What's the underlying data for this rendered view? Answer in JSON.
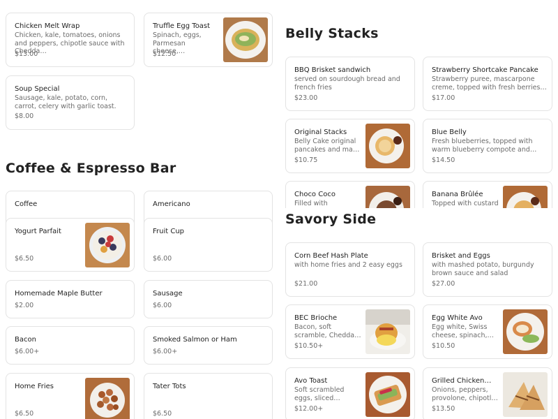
{
  "sections": {
    "coffee": {
      "title": "Coffee & Espresso Bar"
    },
    "belly": {
      "title": "Belly Stacks"
    },
    "savory": {
      "title": "Savory Side"
    }
  },
  "left_top": [
    {
      "name": "Chicken Melt Wrap",
      "desc": "Chicken, kale, tomatoes, onions and peppers, chipotle sauce with Chedda…",
      "price": "$13.00"
    },
    {
      "name": "Truffle Egg Toast",
      "desc": "Spinach, eggs, Parmesan cheese,…",
      "price": "$12.50",
      "icon": "truffle-egg-toast-image"
    },
    {
      "name": "Soup Special",
      "desc": "Sausage, kale, potato, corn, carrot, celery with garlic toast.",
      "price": "$8.00"
    }
  ],
  "coffee_items": [
    {
      "name": "Coffee"
    },
    {
      "name": "Americano"
    },
    {
      "name": "Yogurt Parfait",
      "price": "$6.50",
      "icon": "yogurt-parfait-image"
    },
    {
      "name": "Fruit Cup",
      "price": "$6.00"
    },
    {
      "name": "Homemade Maple Butter",
      "price": "$2.00"
    },
    {
      "name": "Sausage",
      "price": "$6.00"
    },
    {
      "name": "Bacon",
      "price": "$6.00+"
    },
    {
      "name": "Smoked Salmon or Ham",
      "price": "$6.00+"
    },
    {
      "name": "Home Fries",
      "price": "$6.50",
      "icon": "home-fries-image"
    },
    {
      "name": "Tater Tots",
      "price": "$6.50"
    }
  ],
  "belly_items": [
    {
      "name": "BBQ Brisket sandwich",
      "desc": "served on sourdough bread and french fries",
      "price": "$23.00"
    },
    {
      "name": "Strawberry Shortcake Pancake",
      "desc": "Strawberry puree, mascarpone creme, topped with fresh berries with maple…",
      "price": "$17.00"
    },
    {
      "name": "Original Stacks",
      "desc": "Belly Cake original pancakes and ma…",
      "price": "$10.75",
      "icon": "original-stacks-image"
    },
    {
      "name": "Blue Belly",
      "desc": "Fresh blueberries, topped with warm blueberry compote and maple butter…",
      "price": "$14.50"
    },
    {
      "name": "Choco Coco",
      "desc": "Filled with chocolate",
      "icon": "choco-coco-image"
    },
    {
      "name": "Banana Brûlée",
      "desc": "Topped with custard",
      "icon": "banana-brulee-image"
    }
  ],
  "savory_items": [
    {
      "name": "Corn Beef Hash Plate",
      "desc": "with home fries and 2 easy eggs",
      "price": "$21.00"
    },
    {
      "name": "Brisket and Eggs",
      "desc": "with mashed potato, burgundy brown sauce and salad",
      "price": "$27.00"
    },
    {
      "name": "BEC Brioche",
      "desc": "Bacon, soft scramble, Chedda…",
      "price": "$10.50+",
      "icon": "bec-brioche-image"
    },
    {
      "name": "Egg White Avo",
      "desc": "Egg white, Swiss cheese, spinach,…",
      "price": "$10.50",
      "icon": "egg-white-avo-image"
    },
    {
      "name": "Avo Toast",
      "desc": "Soft scrambled eggs, sliced…",
      "price": "$12.00+",
      "icon": "avo-toast-image"
    },
    {
      "name": "Grilled Chicken…",
      "desc": "Onions, peppers, provolone, chipotl…",
      "price": "$13.50",
      "icon": "grilled-chicken-image"
    }
  ]
}
